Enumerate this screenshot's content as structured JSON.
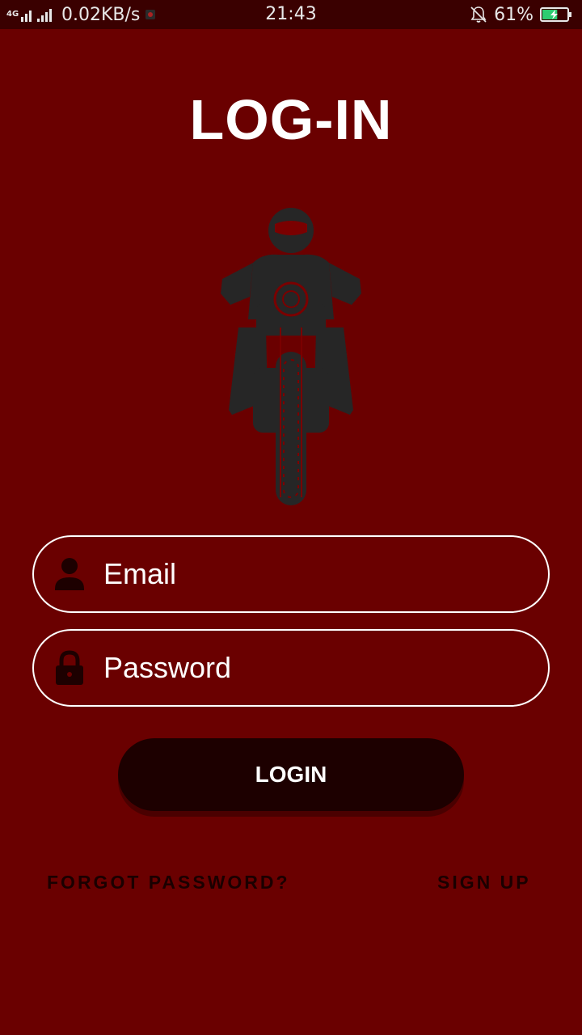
{
  "status_bar": {
    "network_type": "4G",
    "speed": "0.02KB/s",
    "time": "21:43",
    "battery": "61%",
    "battery_level": 0.61
  },
  "title": "LOG-IN",
  "form": {
    "email_placeholder": "Email",
    "password_placeholder": "Password",
    "login_label": "LOGIN"
  },
  "links": {
    "forgot_password": "FORGOT PASSWORD?",
    "sign_up": "SIGN UP"
  },
  "icons": {
    "hero": "motorcycle-rider-icon",
    "email": "person-icon",
    "password": "lock-icon"
  },
  "colors": {
    "background": "#6a0000",
    "status_bar": "#3a0000",
    "button": "#1d0000",
    "field_border": "#ffffff"
  }
}
